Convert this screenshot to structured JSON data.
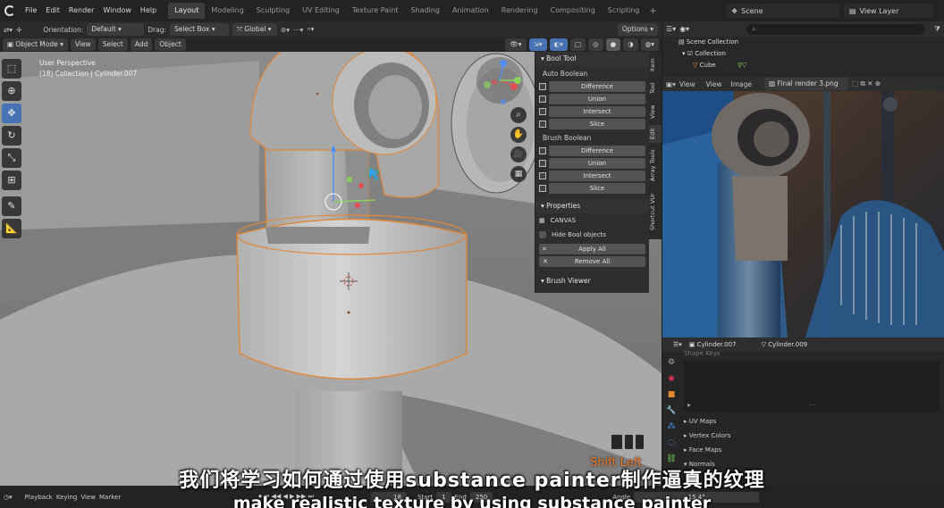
{
  "topbar": {
    "menus": [
      "File",
      "Edit",
      "Render",
      "Window",
      "Help"
    ],
    "workspaces": [
      "Layout",
      "Modeling",
      "Sculpting",
      "UV Editing",
      "Texture Paint",
      "Shading",
      "Animation",
      "Rendering",
      "Compositing",
      "Scripting"
    ],
    "active_workspace": "Layout",
    "scene": "Scene",
    "view_layer": "View Layer"
  },
  "viewport_header": {
    "orientation_label": "Orientation:",
    "orientation_value": "Default",
    "drag_label": "Drag:",
    "drag_value": "Select Box",
    "transform_value": "Global",
    "options": "Options"
  },
  "viewport_header2": {
    "mode": "Object Mode",
    "menus": [
      "View",
      "Select",
      "Add",
      "Object"
    ]
  },
  "viewport": {
    "perspective": "User Perspective",
    "collection_info": "(18) Collection | Cylinder.007"
  },
  "bool_tool": {
    "title": "Bool Tool",
    "auto_title": "Auto Boolean",
    "auto_buttons": [
      "Difference",
      "Union",
      "Intersect",
      "Slice"
    ],
    "brush_title": "Brush Boolean",
    "brush_buttons": [
      "Difference",
      "Union",
      "Intersect",
      "Slice"
    ],
    "properties_title": "Properties",
    "canvas_label": "CANVAS",
    "hide_bool": "Hide Bool objects",
    "apply_all": "Apply All",
    "remove_all": "Remove All",
    "brush_viewer": "Brush Viewer"
  },
  "side_tabs": [
    "Item",
    "Tool",
    "View",
    "Edit",
    "Array Tools",
    "Shortcut VUr"
  ],
  "outliner": {
    "rows": [
      "Scene Collection",
      "Collection",
      "Cube"
    ]
  },
  "image_editor": {
    "menus": [
      "View",
      "View",
      "Image"
    ],
    "image_name": "Final render 3.png"
  },
  "properties": {
    "object_name": "Cylinder.007",
    "data_name": "Cylinder.009",
    "partial_label": "Shape Keys",
    "sections": [
      "UV Maps",
      "Vertex Colors",
      "Face Maps",
      "Normals"
    ]
  },
  "timeline": {
    "items": [
      "Playback",
      "Keying",
      "View",
      "Marker"
    ],
    "current_frame": "18",
    "start_label": "Start",
    "start_value": "1",
    "end_label": "End",
    "end_value": "250",
    "angle_label": "Angle",
    "angle_value": "15.4°"
  },
  "overlay": {
    "shift_left": "Shift Left",
    "subtitle_cn": "我们将学习如何通过使用substance painter制作逼真的纹理",
    "subtitle_en": "make realistic texture by using substance painter"
  }
}
